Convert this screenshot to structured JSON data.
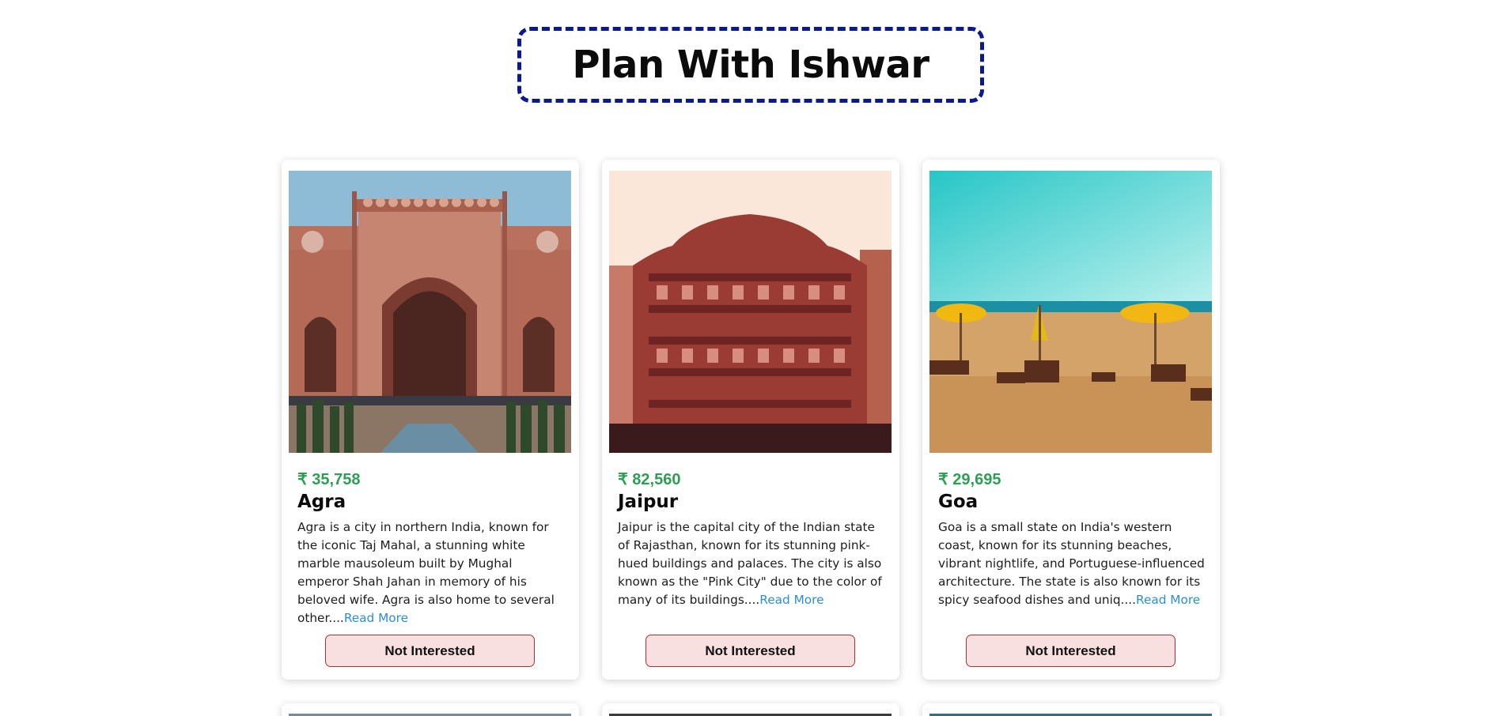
{
  "header": {
    "title": "Plan With Ishwar"
  },
  "cards": [
    {
      "price": "₹ 35,758",
      "name": "Agra",
      "description": "Agra is a city in northern India, known for the iconic Taj Mahal, a stunning white marble mausoleum built by Mughal emperor Shah Jahan in memory of his beloved wife. Agra is also home to several other....",
      "read_more": "Read More",
      "button": "Not Interested"
    },
    {
      "price": "₹ 82,560",
      "name": "Jaipur",
      "description": "Jaipur is the capital city of the Indian state of Rajasthan, known for its stunning pink-hued buildings and palaces. The city is also known as the \"Pink City\" due to the color of many of its buildings....",
      "read_more": "Read More",
      "button": "Not Interested"
    },
    {
      "price": "₹ 29,695",
      "name": "Goa",
      "description": "Goa is a small state on India's western coast, known for its stunning beaches, vibrant nightlife, and Portuguese-influenced architecture. The state is also known for its spicy seafood dishes and uniq....",
      "read_more": "Read More",
      "button": "Not Interested"
    }
  ],
  "colors": {
    "price": "#2e9e55",
    "read_more": "#2a8fd6",
    "title_border": "#0a1a8c",
    "button_bg": "#f8e0e0",
    "button_border": "#a83232"
  }
}
